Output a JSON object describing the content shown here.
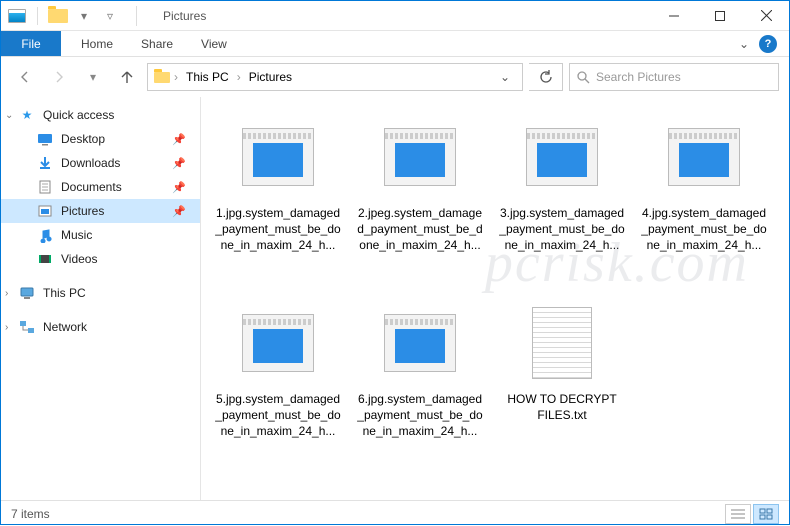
{
  "titlebar": {
    "title": "Pictures"
  },
  "ribbon": {
    "file": "File",
    "tabs": [
      "Home",
      "Share",
      "View"
    ],
    "help": "?"
  },
  "addr": {
    "crumbs": [
      "This PC",
      "Pictures"
    ],
    "search_placeholder": "Search Pictures"
  },
  "sidebar": {
    "quick": "Quick access",
    "items": [
      {
        "label": "Desktop",
        "pinned": true
      },
      {
        "label": "Downloads",
        "pinned": true
      },
      {
        "label": "Documents",
        "pinned": true
      },
      {
        "label": "Pictures",
        "pinned": true,
        "selected": true
      },
      {
        "label": "Music",
        "pinned": false
      },
      {
        "label": "Videos",
        "pinned": false
      }
    ],
    "this_pc": "This PC",
    "network": "Network"
  },
  "files": [
    {
      "type": "img",
      "name": "1.jpg.system_damaged_payment_must_be_done_in_maxim_24_h..."
    },
    {
      "type": "img",
      "name": "2.jpeg.system_damaged_payment_must_be_done_in_maxim_24_h..."
    },
    {
      "type": "img",
      "name": "3.jpg.system_damaged_payment_must_be_done_in_maxim_24_h..."
    },
    {
      "type": "img",
      "name": "4.jpg.system_damaged_payment_must_be_done_in_maxim_24_h..."
    },
    {
      "type": "img",
      "name": "5.jpg.system_damaged_payment_must_be_done_in_maxim_24_h..."
    },
    {
      "type": "img",
      "name": "6.jpg.system_damaged_payment_must_be_done_in_maxim_24_h..."
    },
    {
      "type": "txt",
      "name": "HOW TO DECRYPT FILES.txt"
    }
  ],
  "statusbar": {
    "count": "7 items"
  },
  "watermark": "pcrisk.com"
}
